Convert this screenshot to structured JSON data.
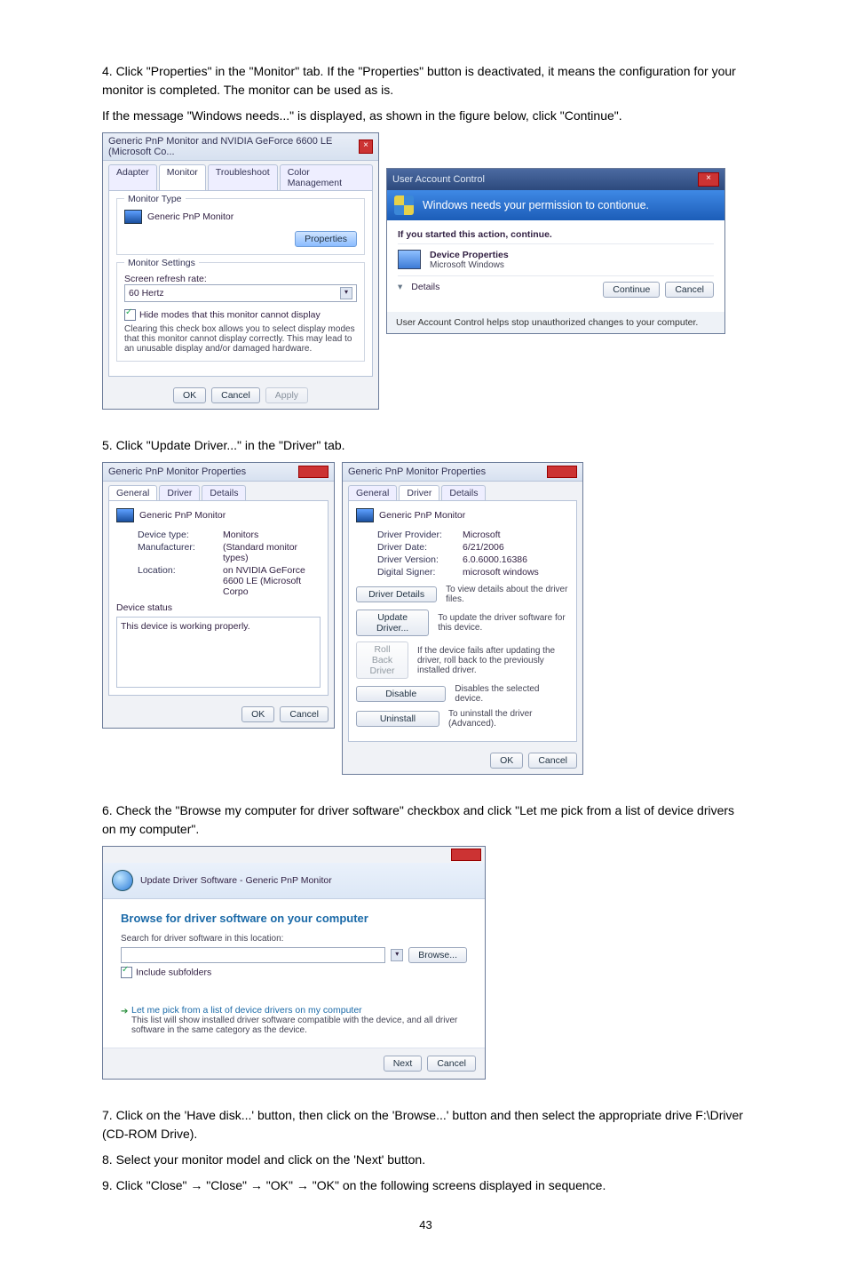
{
  "s4a": "4. Click \"Properties\" in the \"Monitor\" tab. If the \"Properties\" button is deactivated, it means the configuration for your monitor is completed. The monitor can be used as is.",
  "s4b": "If the message \"Windows needs...\" is displayed, as shown in the figure below, click \"Continue\".",
  "s5": "5. Click \"Update Driver...\" in the \"Driver\" tab.",
  "s6": "6. Check the \"Browse my computer for driver software\" checkbox and click \"Let me pick from a list of device drivers on my computer\".",
  "s7": "7. Click on the 'Have disk...' button, then click on the 'Browse...' button and then select the appropriate drive F:\\Driver (CD-ROM Drive).",
  "s8": "8. Select your monitor model and click on the 'Next' button.",
  "s9": "9. Click \"Close\"  →  \"Close\"  →  \"OK\"  →  \"OK\" on the following screens displayed in sequence.",
  "page": "43",
  "d1": {
    "title": "Generic PnP Monitor and NVIDIA GeForce 6600 LE (Microsoft Co...",
    "tabs": [
      "Adapter",
      "Monitor",
      "Troubleshoot",
      "Color Management"
    ],
    "g1": "Monitor Type",
    "mon": "Generic PnP Monitor",
    "prop": "Properties",
    "g2": "Monitor Settings",
    "rr": "Screen refresh rate:",
    "hz": "60 Hertz",
    "hide": "Hide modes that this monitor cannot display",
    "note": "Clearing this check box allows you to select display modes that this monitor cannot display correctly. This may lead to an unusable display and/or damaged hardware.",
    "ok": "OK",
    "cancel": "Cancel",
    "apply": "Apply"
  },
  "uac": {
    "title": "User Account Control",
    "msg": "Windows needs your permission to contionue.",
    "if": "If you started this action, continue.",
    "dp": "Device Properties",
    "mw": "Microsoft Windows",
    "det": "Details",
    "cont": "Continue",
    "cancel": "Cancel",
    "help": "User Account Control helps stop unauthorized changes to your computer."
  },
  "p1": {
    "title": "Generic PnP Monitor Properties",
    "tabs": [
      "General",
      "Driver",
      "Details"
    ],
    "mon": "Generic PnP Monitor",
    "kv": [
      [
        "Device type:",
        "Monitors"
      ],
      [
        "Manufacturer:",
        "(Standard monitor types)"
      ],
      [
        "Location:",
        "on NVIDIA GeForce 6600 LE (Microsoft Corpo"
      ]
    ],
    "ds": "Device status",
    "work": "This device is working properly.",
    "ok": "OK",
    "cancel": "Cancel"
  },
  "p2": {
    "title": "Generic PnP Monitor Properties",
    "tabs": [
      "General",
      "Driver",
      "Details"
    ],
    "mon": "Generic PnP Monitor",
    "kv": [
      [
        "Driver Provider:",
        "Microsoft"
      ],
      [
        "Driver Date:",
        "6/21/2006"
      ],
      [
        "Driver Version:",
        "6.0.6000.16386"
      ],
      [
        "Digital Signer:",
        "microsoft windows"
      ]
    ],
    "rows": [
      [
        "Driver Details",
        "To view details about the driver files."
      ],
      [
        "Update Driver...",
        "To update the driver software for this device."
      ],
      [
        "Roll Back Driver",
        "If the device fails after updating the driver, roll back to the previously installed driver."
      ],
      [
        "Disable",
        "Disables the selected device."
      ],
      [
        "Uninstall",
        "To uninstall the driver (Advanced)."
      ]
    ],
    "ok": "OK",
    "cancel": "Cancel"
  },
  "wiz": {
    "title": "Update Driver Software - Generic PnP Monitor",
    "h": "Browse for driver software on your computer",
    "srch": "Search for driver software in this location:",
    "browse": "Browse...",
    "inc": "Include subfolders",
    "let": "Let me pick from a list of device drivers on my computer",
    "letd": "This list will show installed driver software compatible with the device, and all driver software in the same category as the device.",
    "next": "Next",
    "cancel": "Cancel"
  }
}
